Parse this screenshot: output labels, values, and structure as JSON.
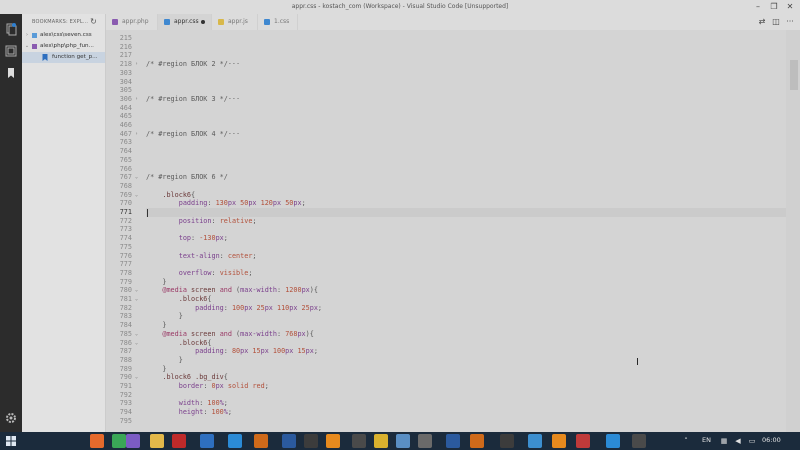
{
  "window": {
    "title": "appr.css - kostach_com (Workspace) - Visual Studio Code [Unsupported]"
  },
  "sidebar": {
    "header": "BOOKMARKS: EXPL...",
    "items": [
      {
        "label": "alex\\css\\seven.css",
        "twisty": "›",
        "icon_color": "#5a9bd8"
      },
      {
        "label": "alex\\php\\php_fun...",
        "twisty": "⌄",
        "icon_color": "#8a5bb0"
      },
      {
        "label": "function get_p...",
        "twisty": "",
        "icon_color": "#2e6fbf"
      }
    ]
  },
  "tabs": [
    {
      "label": "appr.php",
      "icon_color": "#8a5bb0",
      "state": "inactive"
    },
    {
      "label": "appr.css",
      "icon_color": "#3f88d0",
      "state": "active-dirty"
    },
    {
      "label": "appr.js",
      "icon_color": "#d8b84a",
      "state": "inactive"
    },
    {
      "label": "1.css",
      "icon_color": "#3f88d0",
      "state": "inactive"
    }
  ],
  "editor": {
    "current_line": "771",
    "lines": [
      {
        "n": "215",
        "fold": "",
        "tokens": []
      },
      {
        "n": "216",
        "fold": "",
        "tokens": []
      },
      {
        "n": "217",
        "fold": "",
        "tokens": []
      },
      {
        "n": "218",
        "fold": "›",
        "tokens": [
          {
            "c": "t-com",
            "t": "/* #region БЛОК 2 */···"
          }
        ]
      },
      {
        "n": "303",
        "fold": "",
        "tokens": []
      },
      {
        "n": "304",
        "fold": "",
        "tokens": []
      },
      {
        "n": "305",
        "fold": "",
        "tokens": []
      },
      {
        "n": "306",
        "fold": "›",
        "tokens": [
          {
            "c": "t-com",
            "t": "/* #region БЛОК 3 */···"
          }
        ]
      },
      {
        "n": "464",
        "fold": "",
        "tokens": []
      },
      {
        "n": "465",
        "fold": "",
        "tokens": []
      },
      {
        "n": "466",
        "fold": "",
        "tokens": []
      },
      {
        "n": "467",
        "fold": "›",
        "tokens": [
          {
            "c": "t-com",
            "t": "/* #region БЛОК 4 */···"
          }
        ]
      },
      {
        "n": "763",
        "fold": "",
        "tokens": []
      },
      {
        "n": "764",
        "fold": "",
        "tokens": []
      },
      {
        "n": "765",
        "fold": "",
        "tokens": []
      },
      {
        "n": "766",
        "fold": "",
        "tokens": []
      },
      {
        "n": "767",
        "fold": "⌄",
        "tokens": [
          {
            "c": "t-com",
            "t": "/* #region БЛОК 6 */"
          }
        ]
      },
      {
        "n": "768",
        "fold": "",
        "tokens": []
      },
      {
        "n": "769",
        "fold": "⌄",
        "tokens": [
          {
            "c": "t-pun",
            "t": "    "
          },
          {
            "c": "t-sel",
            "t": ".block6"
          },
          {
            "c": "t-pun",
            "t": "{"
          }
        ]
      },
      {
        "n": "770",
        "fold": "",
        "tokens": [
          {
            "c": "t-pun",
            "t": "        "
          },
          {
            "c": "t-prop",
            "t": "padding"
          },
          {
            "c": "t-pun",
            "t": ": "
          },
          {
            "c": "t-num",
            "t": "130"
          },
          {
            "c": "t-unit",
            "t": "px"
          },
          {
            "c": "t-pun",
            "t": " "
          },
          {
            "c": "t-num",
            "t": "50"
          },
          {
            "c": "t-unit",
            "t": "px"
          },
          {
            "c": "t-pun",
            "t": " "
          },
          {
            "c": "t-num",
            "t": "120"
          },
          {
            "c": "t-unit",
            "t": "px"
          },
          {
            "c": "t-pun",
            "t": " "
          },
          {
            "c": "t-num",
            "t": "50"
          },
          {
            "c": "t-unit",
            "t": "px"
          },
          {
            "c": "t-pun",
            "t": ";"
          }
        ]
      },
      {
        "n": "771",
        "fold": "",
        "tokens": []
      },
      {
        "n": "772",
        "fold": "",
        "tokens": [
          {
            "c": "t-pun",
            "t": "        "
          },
          {
            "c": "t-prop",
            "t": "position"
          },
          {
            "c": "t-pun",
            "t": ": "
          },
          {
            "c": "t-val",
            "t": "relative"
          },
          {
            "c": "t-pun",
            "t": ";"
          }
        ]
      },
      {
        "n": "773",
        "fold": "",
        "tokens": []
      },
      {
        "n": "774",
        "fold": "",
        "tokens": [
          {
            "c": "t-pun",
            "t": "        "
          },
          {
            "c": "t-prop",
            "t": "top"
          },
          {
            "c": "t-pun",
            "t": ": "
          },
          {
            "c": "t-num",
            "t": "-130"
          },
          {
            "c": "t-unit",
            "t": "px"
          },
          {
            "c": "t-pun",
            "t": ";"
          }
        ]
      },
      {
        "n": "775",
        "fold": "",
        "tokens": []
      },
      {
        "n": "776",
        "fold": "",
        "tokens": [
          {
            "c": "t-pun",
            "t": "        "
          },
          {
            "c": "t-prop",
            "t": "text-align"
          },
          {
            "c": "t-pun",
            "t": ": "
          },
          {
            "c": "t-val",
            "t": "center"
          },
          {
            "c": "t-pun",
            "t": ";"
          }
        ]
      },
      {
        "n": "777",
        "fold": "",
        "tokens": []
      },
      {
        "n": "778",
        "fold": "",
        "tokens": [
          {
            "c": "t-pun",
            "t": "        "
          },
          {
            "c": "t-prop",
            "t": "overflow"
          },
          {
            "c": "t-pun",
            "t": ": "
          },
          {
            "c": "t-val",
            "t": "visible"
          },
          {
            "c": "t-pun",
            "t": ";"
          }
        ]
      },
      {
        "n": "779",
        "fold": "",
        "tokens": [
          {
            "c": "t-pun",
            "t": "    }"
          }
        ]
      },
      {
        "n": "780",
        "fold": "⌄",
        "tokens": [
          {
            "c": "t-pun",
            "t": "    "
          },
          {
            "c": "t-kw",
            "t": "@media"
          },
          {
            "c": "t-pun",
            "t": " "
          },
          {
            "c": "t-sel",
            "t": "screen"
          },
          {
            "c": "t-pun",
            "t": " "
          },
          {
            "c": "t-kw",
            "t": "and"
          },
          {
            "c": "t-pun",
            "t": " ("
          },
          {
            "c": "t-prop",
            "t": "max-width"
          },
          {
            "c": "t-pun",
            "t": ": "
          },
          {
            "c": "t-num",
            "t": "1200"
          },
          {
            "c": "t-unit",
            "t": "px"
          },
          {
            "c": "t-pun",
            "t": "){"
          }
        ]
      },
      {
        "n": "781",
        "fold": "⌄",
        "tokens": [
          {
            "c": "t-pun",
            "t": "        "
          },
          {
            "c": "t-sel",
            "t": ".block6"
          },
          {
            "c": "t-pun",
            "t": "{"
          }
        ]
      },
      {
        "n": "782",
        "fold": "",
        "tokens": [
          {
            "c": "t-pun",
            "t": "            "
          },
          {
            "c": "t-prop",
            "t": "padding"
          },
          {
            "c": "t-pun",
            "t": ": "
          },
          {
            "c": "t-num",
            "t": "100"
          },
          {
            "c": "t-unit",
            "t": "px"
          },
          {
            "c": "t-pun",
            "t": " "
          },
          {
            "c": "t-num",
            "t": "25"
          },
          {
            "c": "t-unit",
            "t": "px"
          },
          {
            "c": "t-pun",
            "t": " "
          },
          {
            "c": "t-num",
            "t": "110"
          },
          {
            "c": "t-unit",
            "t": "px"
          },
          {
            "c": "t-pun",
            "t": " "
          },
          {
            "c": "t-num",
            "t": "25"
          },
          {
            "c": "t-unit",
            "t": "px"
          },
          {
            "c": "t-pun",
            "t": ";"
          }
        ]
      },
      {
        "n": "783",
        "fold": "",
        "tokens": [
          {
            "c": "t-pun",
            "t": "        }"
          }
        ]
      },
      {
        "n": "784",
        "fold": "",
        "tokens": [
          {
            "c": "t-pun",
            "t": "    }"
          }
        ]
      },
      {
        "n": "785",
        "fold": "⌄",
        "tokens": [
          {
            "c": "t-pun",
            "t": "    "
          },
          {
            "c": "t-kw",
            "t": "@media"
          },
          {
            "c": "t-pun",
            "t": " "
          },
          {
            "c": "t-sel",
            "t": "screen"
          },
          {
            "c": "t-pun",
            "t": " "
          },
          {
            "c": "t-kw",
            "t": "and"
          },
          {
            "c": "t-pun",
            "t": " ("
          },
          {
            "c": "t-prop",
            "t": "max-width"
          },
          {
            "c": "t-pun",
            "t": ": "
          },
          {
            "c": "t-num",
            "t": "768"
          },
          {
            "c": "t-unit",
            "t": "px"
          },
          {
            "c": "t-pun",
            "t": "){"
          }
        ]
      },
      {
        "n": "786",
        "fold": "⌄",
        "tokens": [
          {
            "c": "t-pun",
            "t": "        "
          },
          {
            "c": "t-sel",
            "t": ".block6"
          },
          {
            "c": "t-pun",
            "t": "{"
          }
        ]
      },
      {
        "n": "787",
        "fold": "",
        "tokens": [
          {
            "c": "t-pun",
            "t": "            "
          },
          {
            "c": "t-prop",
            "t": "padding"
          },
          {
            "c": "t-pun",
            "t": ": "
          },
          {
            "c": "t-num",
            "t": "80"
          },
          {
            "c": "t-unit",
            "t": "px"
          },
          {
            "c": "t-pun",
            "t": " "
          },
          {
            "c": "t-num",
            "t": "15"
          },
          {
            "c": "t-unit",
            "t": "px"
          },
          {
            "c": "t-pun",
            "t": " "
          },
          {
            "c": "t-num",
            "t": "100"
          },
          {
            "c": "t-unit",
            "t": "px"
          },
          {
            "c": "t-pun",
            "t": " "
          },
          {
            "c": "t-num",
            "t": "15"
          },
          {
            "c": "t-unit",
            "t": "px"
          },
          {
            "c": "t-pun",
            "t": ";"
          }
        ]
      },
      {
        "n": "788",
        "fold": "",
        "tokens": [
          {
            "c": "t-pun",
            "t": "        }"
          }
        ]
      },
      {
        "n": "789",
        "fold": "",
        "tokens": [
          {
            "c": "t-pun",
            "t": "    }"
          }
        ]
      },
      {
        "n": "790",
        "fold": "⌄",
        "tokens": [
          {
            "c": "t-pun",
            "t": "    "
          },
          {
            "c": "t-sel",
            "t": ".block6 .bg_div"
          },
          {
            "c": "t-pun",
            "t": "{"
          }
        ]
      },
      {
        "n": "791",
        "fold": "",
        "tokens": [
          {
            "c": "t-pun",
            "t": "        "
          },
          {
            "c": "t-prop",
            "t": "border"
          },
          {
            "c": "t-pun",
            "t": ": "
          },
          {
            "c": "t-num",
            "t": "0"
          },
          {
            "c": "t-unit",
            "t": "px"
          },
          {
            "c": "t-pun",
            "t": " "
          },
          {
            "c": "t-val",
            "t": "solid"
          },
          {
            "c": "t-pun",
            "t": " "
          },
          {
            "c": "t-val",
            "t": "red"
          },
          {
            "c": "t-pun",
            "t": ";"
          }
        ]
      },
      {
        "n": "792",
        "fold": "",
        "tokens": []
      },
      {
        "n": "793",
        "fold": "",
        "tokens": [
          {
            "c": "t-pun",
            "t": "        "
          },
          {
            "c": "t-prop",
            "t": "width"
          },
          {
            "c": "t-pun",
            "t": ": "
          },
          {
            "c": "t-num",
            "t": "100"
          },
          {
            "c": "t-unit",
            "t": "%"
          },
          {
            "c": "t-pun",
            "t": ";"
          }
        ]
      },
      {
        "n": "794",
        "fold": "",
        "tokens": [
          {
            "c": "t-pun",
            "t": "        "
          },
          {
            "c": "t-prop",
            "t": "height"
          },
          {
            "c": "t-pun",
            "t": ": "
          },
          {
            "c": "t-num",
            "t": "100"
          },
          {
            "c": "t-unit",
            "t": "%"
          },
          {
            "c": "t-pun",
            "t": ";"
          }
        ]
      },
      {
        "n": "795",
        "fold": "",
        "tokens": []
      }
    ]
  },
  "taskbar": {
    "apps": [
      {
        "name": "start-button",
        "color": "#2d7fd0"
      },
      {
        "name": "firefox-app",
        "color": "#e66a2c"
      },
      {
        "name": "chrome-app",
        "color": "#3aa757"
      },
      {
        "name": "viber-app",
        "color": "#7b5cc4"
      },
      {
        "name": "explorer-app",
        "color": "#e3b84a"
      },
      {
        "name": "filezilla-app",
        "color": "#bf2a2a"
      },
      {
        "name": "outlook-app",
        "color": "#2e6fbf"
      },
      {
        "name": "vscode-app",
        "color": "#2b8bd6"
      },
      {
        "name": "illustrator-app",
        "color": "#cf6a1a"
      },
      {
        "name": "photoshop-app",
        "color": "#2b5a9e"
      },
      {
        "name": "terminal-app",
        "color": "#3c3c3c"
      },
      {
        "name": "vlc-app",
        "color": "#e78a1e"
      }
    ],
    "language": "EN",
    "clock": "06:00"
  }
}
